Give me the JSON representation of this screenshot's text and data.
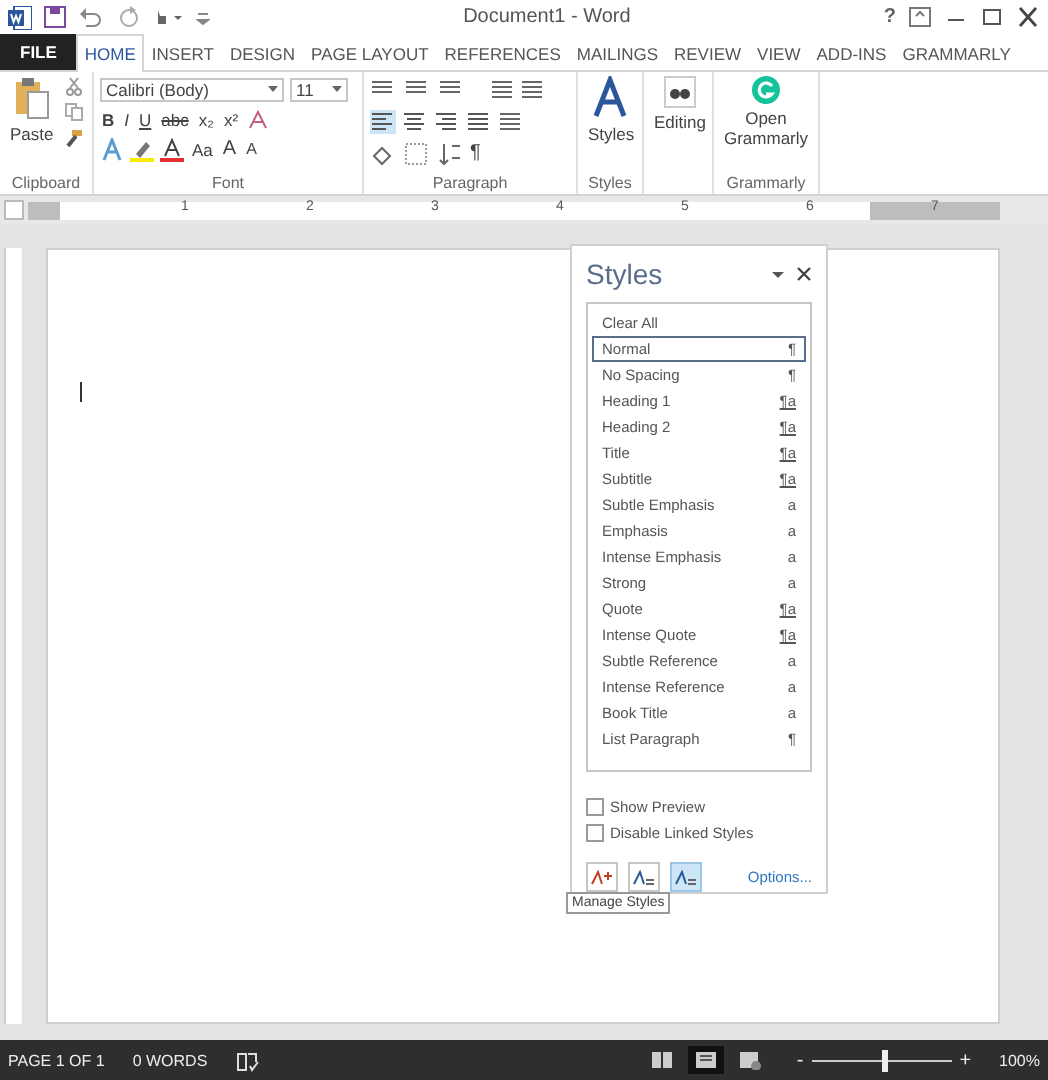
{
  "window": {
    "title": "Document1 - Word",
    "help": "?"
  },
  "tabs": [
    {
      "label": "FILE",
      "kind": "file",
      "selected": false
    },
    {
      "label": "HOME",
      "kind": "tab",
      "selected": true
    },
    {
      "label": "INSERT",
      "kind": "tab",
      "selected": false
    },
    {
      "label": "DESIGN",
      "kind": "tab",
      "selected": false
    },
    {
      "label": "PAGE LAYOUT",
      "kind": "tab",
      "selected": false
    },
    {
      "label": "REFERENCES",
      "kind": "tab",
      "selected": false
    },
    {
      "label": "MAILINGS",
      "kind": "tab",
      "selected": false
    },
    {
      "label": "REVIEW",
      "kind": "tab",
      "selected": false
    },
    {
      "label": "VIEW",
      "kind": "tab",
      "selected": false
    },
    {
      "label": "ADD-INS",
      "kind": "tab",
      "selected": false
    },
    {
      "label": "GRAMMARLY",
      "kind": "tab",
      "selected": false
    }
  ],
  "ribbon": {
    "clipboard": {
      "paste": "Paste",
      "label": "Clipboard"
    },
    "font": {
      "face": "Calibri (Body)",
      "size": "11",
      "format_buttons": [
        "B",
        "I",
        "U",
        "abc",
        "x₂",
        "x²"
      ],
      "case_button": "Aa",
      "grow_button": "A",
      "shrink_button": "A",
      "label": "Font"
    },
    "paragraph": {
      "pilcrow": "¶",
      "label": "Paragraph",
      "align": [
        {
          "selected": true
        },
        {
          "selected": false
        },
        {
          "selected": false
        },
        {
          "selected": false
        }
      ]
    },
    "styles": {
      "button": "Styles",
      "label": "Styles"
    },
    "editing": {
      "button": "Editing"
    },
    "grammarly": {
      "button": "Open Grammarly",
      "label": "Grammarly"
    }
  },
  "ruler": {
    "numbers": [
      "1",
      "2",
      "3",
      "4",
      "5",
      "6",
      "7"
    ]
  },
  "styles_pane": {
    "title": "Styles",
    "items": [
      {
        "name": "Clear All",
        "selected": false
      },
      {
        "name": "Normal",
        "mark": "¶",
        "selected": true
      },
      {
        "name": "No Spacing",
        "mark": "¶",
        "selected": false
      },
      {
        "name": "Heading 1",
        "mark": "¶a",
        "selected": false
      },
      {
        "name": "Heading 2",
        "mark": "¶a",
        "selected": false
      },
      {
        "name": "Title",
        "mark": "¶a",
        "selected": false
      },
      {
        "name": "Subtitle",
        "mark": "¶a",
        "selected": false
      },
      {
        "name": "Subtle Emphasis",
        "mark": "a",
        "selected": false
      },
      {
        "name": "Emphasis",
        "mark": "a",
        "selected": false
      },
      {
        "name": "Intense Emphasis",
        "mark": "a",
        "selected": false
      },
      {
        "name": "Strong",
        "mark": "a",
        "selected": false
      },
      {
        "name": "Quote",
        "mark": "¶a",
        "selected": false
      },
      {
        "name": "Intense Quote",
        "mark": "¶a",
        "selected": false
      },
      {
        "name": "Subtle Reference",
        "mark": "a",
        "selected": false
      },
      {
        "name": "Intense Reference",
        "mark": "a",
        "selected": false
      },
      {
        "name": "Book Title",
        "mark": "a",
        "selected": false
      },
      {
        "name": "List Paragraph",
        "mark": "¶",
        "selected": false
      }
    ],
    "options": [
      {
        "label": "Show Preview",
        "checked": false
      },
      {
        "label": "Disable Linked Styles",
        "checked": false
      }
    ],
    "buttons": [
      {
        "kind": "new",
        "highlighted": false
      },
      {
        "kind": "inspect",
        "highlighted": false
      },
      {
        "kind": "manage",
        "highlighted": true
      }
    ],
    "link": "Options...",
    "tooltip": "Manage Styles"
  },
  "status_bar": {
    "page": "PAGE 1 OF 1",
    "words": "0 WORDS",
    "views": [
      {
        "kind": "read",
        "selected": false
      },
      {
        "kind": "print",
        "selected": true
      },
      {
        "kind": "web",
        "selected": false
      }
    ],
    "zoom_out": "-",
    "zoom_in": "+",
    "zoom": {
      "level": 0.52
    },
    "zoom_label": "100%"
  }
}
